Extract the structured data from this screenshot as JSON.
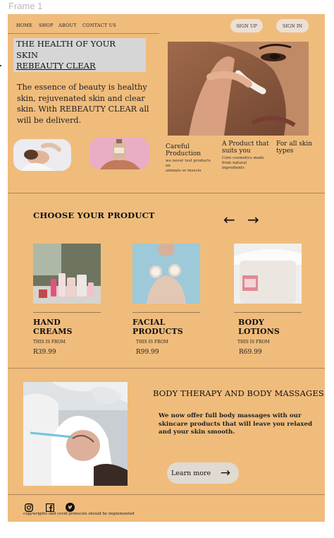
{
  "frame": {
    "label": "Frame 1"
  },
  "nav": {
    "links": [
      "HOME",
      "SHOP",
      "ABOUT",
      "CONTACT US"
    ],
    "sign_up": "SIGN UP",
    "sign_in": "SIGN IN"
  },
  "hero": {
    "title_line1": "THE HEALTH OF YOUR",
    "title_line2": "SKIN",
    "title_line3": "REBEAUTY CLEAR",
    "text": "The essence of beauty is healthy skin, rejuvenated skin and clear skin. With REBEAUTY CLEAR all will be deliverd."
  },
  "features": [
    {
      "title": "Careful Production",
      "desc_line1": "we never test products on",
      "desc_line2": "animals or insects"
    },
    {
      "title": "A Product that suits you",
      "desc": "Core cosmetics made from natural ingredients"
    },
    {
      "title": "For all skin types"
    }
  ],
  "products": {
    "title": "CHOOSE YOUR PRODUCT",
    "prev_icon": "arrow-left-icon",
    "next_icon": "arrow-right-icon",
    "items": [
      {
        "name": "HAND CREAMS",
        "from_label": "THIS IS FROM",
        "price": "R39.99"
      },
      {
        "name": "FACIAL PRODUCTS",
        "from_label": "THIS IS FROM",
        "price": "R99.99"
      },
      {
        "name": "BODY LOTIONS",
        "from_label": "THIS IS FROM",
        "price": "R69.99"
      }
    ]
  },
  "therapy": {
    "title": "BODY THERAPY AND BODY MASSAGES",
    "text": "We now offer full body massages with our skincare products that will leave you relaxed and your skin smooth.",
    "button": "Learn more"
  },
  "footer": {
    "icons": [
      "instagram-icon",
      "facebook-icon",
      "twitter-icon"
    ],
    "copyright": "copywrights and covid protocols should be implemented"
  },
  "colors": {
    "background": "#f0bc7c",
    "pill": "#ece0d4",
    "title_box": "#d6d6d6",
    "button": "#e0dad2"
  }
}
